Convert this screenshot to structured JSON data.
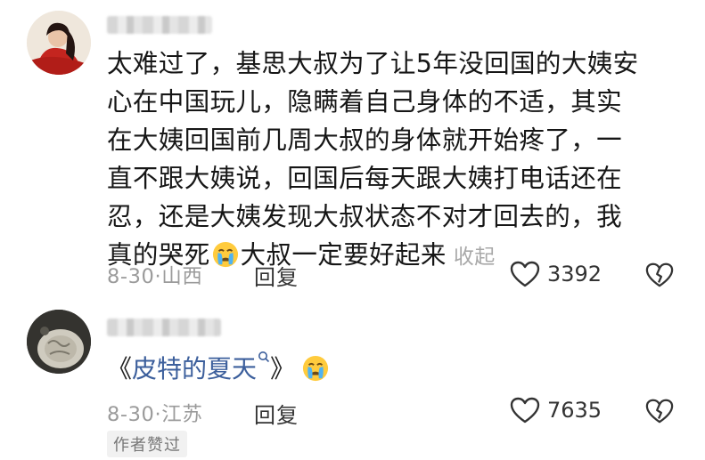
{
  "comments": [
    {
      "lines": [
        "太难过了，基思大叔为了让5年没回国的大姨安",
        "心在中国玩儿，隐瞒着自己身体的不适，其实",
        "在大姨回国前几周大叔的身体就开始疼了，一",
        "直不跟大姨说，回国后每天跟大姨打电话还在",
        "忍，还是大姨发现大叔状态不对才回去的，我"
      ],
      "last_line_before_emoji": "真的哭死",
      "last_line_after_emoji": "大叔一定要好起来",
      "emoji_icon": "crying-face",
      "collapse_label": "收起",
      "date": "8-30",
      "location": "山西",
      "reply_label": "回复",
      "like_count": "3392"
    },
    {
      "quote_open": "《",
      "quote_title": "皮特的夏天",
      "quote_close": "》",
      "search_icon": "search-icon",
      "emoji_icon": "crying-face",
      "date": "8-30",
      "location": "江苏",
      "reply_label": "回复",
      "like_count": "7635",
      "author_badge": "作者赞过"
    }
  ],
  "colors": {
    "text": "#161616",
    "meta": "#9b9b9b",
    "link": "#3c5f9c",
    "badge_bg": "#f1f1f1"
  }
}
